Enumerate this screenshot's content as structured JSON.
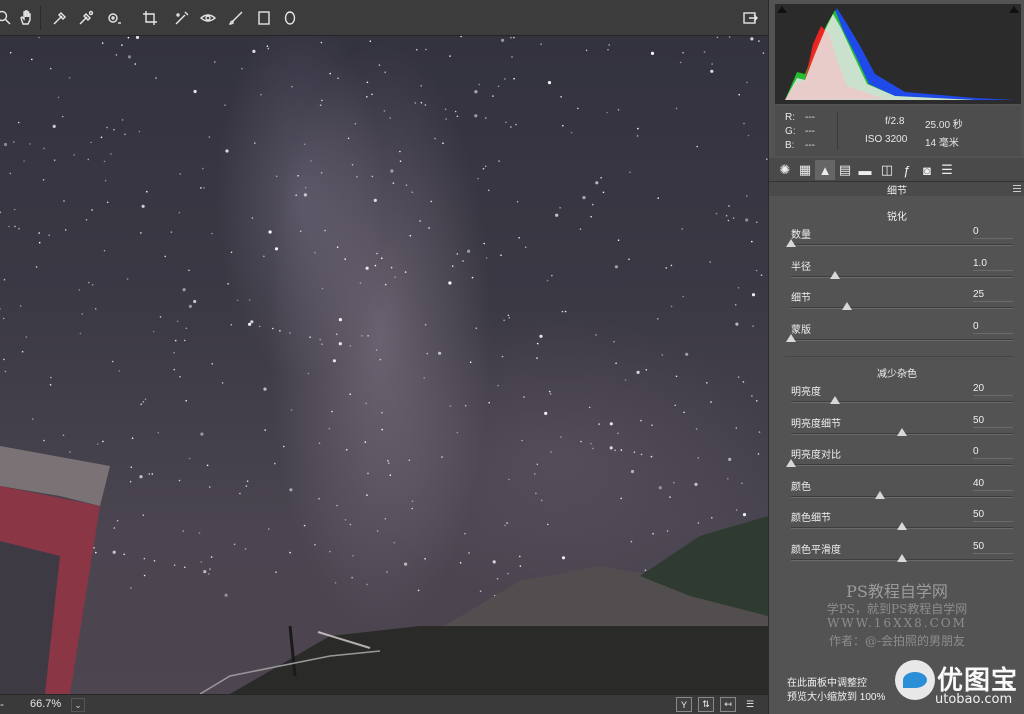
{
  "toolbar": {
    "tools": [
      "zoom-icon",
      "hand-icon",
      "white-balance-icon",
      "color-sampler-icon",
      "targeted-adjustment-icon",
      "crop-icon",
      "spot-removal-icon",
      "red-eye-icon",
      "adjustment-brush-icon",
      "graduated-filter-icon",
      "radial-filter-icon"
    ],
    "open_label": "⇱"
  },
  "status": {
    "zoom": "66.7%"
  },
  "info": {
    "r_label": "R:",
    "r_value": "---",
    "g_label": "G:",
    "g_value": "---",
    "b_label": "B:",
    "b_value": "---",
    "aperture": "f/2.8",
    "shutter": "25.00 秒",
    "iso": "ISO 3200",
    "focal": "14 毫米"
  },
  "panel": {
    "section": "细节",
    "sharpening": {
      "title": "锐化",
      "sliders": [
        {
          "label": "数量",
          "value": "0",
          "fraction": 0.0
        },
        {
          "label": "半径",
          "value": "1.0",
          "fraction": 0.2
        },
        {
          "label": "细节",
          "value": "25",
          "fraction": 0.25
        },
        {
          "label": "蒙版",
          "value": "0",
          "fraction": 0.0
        }
      ]
    },
    "noise": {
      "title": "减少杂色",
      "sliders": [
        {
          "label": "明亮度",
          "value": "20",
          "fraction": 0.2
        },
        {
          "label": "明亮度细节",
          "value": "50",
          "fraction": 0.5
        },
        {
          "label": "明亮度对比",
          "value": "0",
          "fraction": 0.0
        },
        {
          "label": "颜色",
          "value": "40",
          "fraction": 0.4
        },
        {
          "label": "颜色细节",
          "value": "50",
          "fraction": 0.5
        },
        {
          "label": "颜色平滑度",
          "value": "50",
          "fraction": 0.5
        }
      ]
    }
  },
  "watermark": {
    "line1": "PS教程自学网",
    "line2": "学PS，就到PS教程自学网",
    "line3": "WWW.16XX8.COM",
    "line4": "作者：@-会拍照的男朋友"
  },
  "footer": {
    "note1": "在此面板中调整控",
    "note2": "预览大小缩放到 100%"
  },
  "logo": {
    "title": "优图宝",
    "url": "utobao.com"
  }
}
